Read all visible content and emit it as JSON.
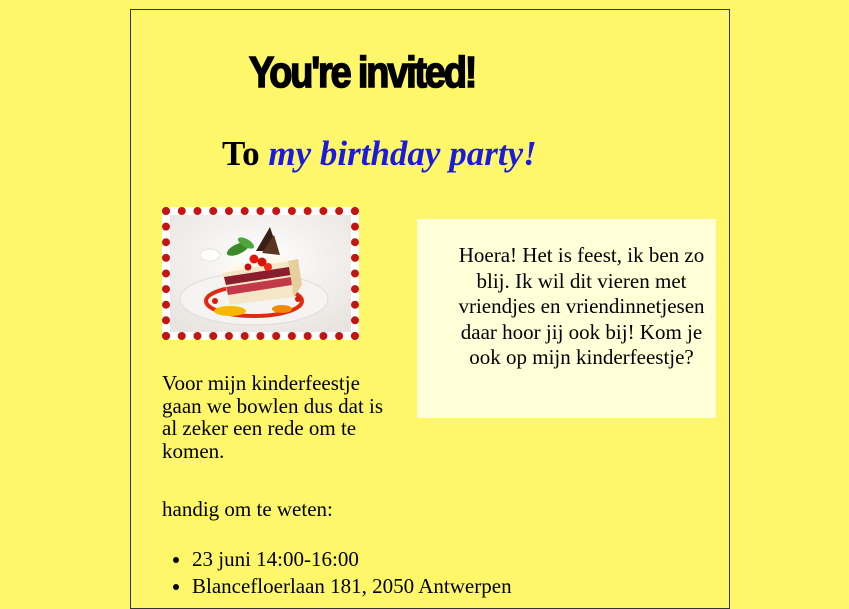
{
  "invite": {
    "headline": "You're invited!",
    "subhead_prefix": "To ",
    "subhead_emphasis": "my birthday party!",
    "photo_alt": "slice of cake",
    "bubble_text": "Hoera! Het is feest, ik ben zo blij. Ik wil dit vieren met vriendjes en vriendinnetjesen daar hoor jij ook bij! Kom je ook op mijn kinderfeestje?",
    "body_text": "Voor mijn kinderfeestje gaan we bowlen dus dat is al zeker een rede om te komen.",
    "info_heading": "handig om te weten:",
    "info_items": [
      "23 juni 14:00-16:00",
      "Blancefloerlaan 181, 2050 Antwerpen"
    ]
  },
  "colors": {
    "page_background": "#fff76a",
    "bubble_background": "#ffffd8",
    "emphasis": "#1b1be0",
    "photo_border": "#c41515"
  }
}
